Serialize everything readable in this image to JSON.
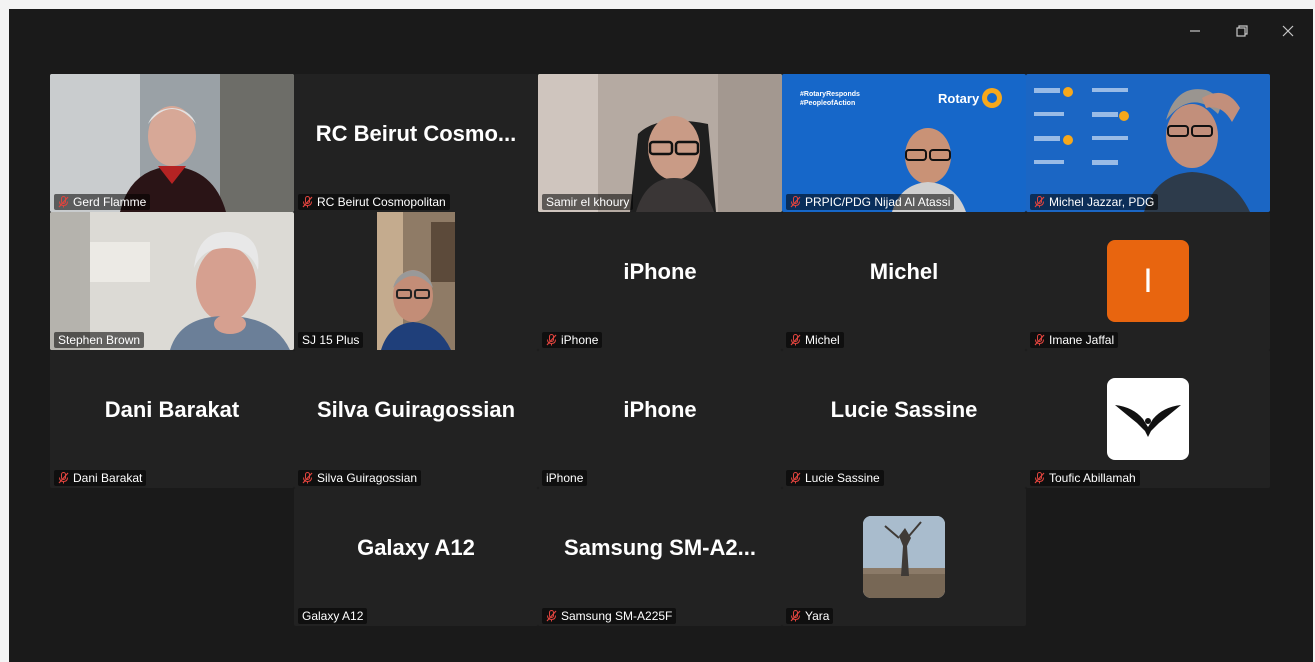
{
  "window_controls": {
    "minimize": "—",
    "restore": "❐",
    "close": "✕"
  },
  "participants": [
    {
      "name": "Gerd Flamme",
      "muted": true
    },
    {
      "name": "RC Beirut Cosmopolitan",
      "display": "RC Beirut Cosmo...",
      "muted": true
    },
    {
      "name": "Samir el khoury",
      "muted": false,
      "active_speaker": true
    },
    {
      "name": "PRPIC/PDG  Nijad Al Atassi",
      "muted": true,
      "banner": {
        "tags": "#RotaryResponds\n#PeopleofAction",
        "logo": "Rotary"
      }
    },
    {
      "name": "Michel Jazzar, PDG",
      "muted": true
    },
    {
      "name": "Stephen Brown",
      "muted": false
    },
    {
      "name": "SJ 15 Plus",
      "muted": false
    },
    {
      "name": "iPhone",
      "display": "iPhone",
      "muted": true
    },
    {
      "name": "Michel",
      "display": "Michel",
      "muted": true
    },
    {
      "name": "Imane Jaffal",
      "muted": true,
      "avatar_letter": "I",
      "avatar_color": "#e8650f"
    },
    {
      "name": "Dani Barakat",
      "display": "Dani Barakat",
      "muted": true
    },
    {
      "name": "Silva Guiragossian",
      "display": "Silva Guiragossian",
      "muted": true
    },
    {
      "name": "iPhone",
      "display": "iPhone",
      "muted": false
    },
    {
      "name": "Lucie Sassine",
      "display": "Lucie Sassine",
      "muted": true
    },
    {
      "name": "Toufic Abillamah",
      "muted": true,
      "avatar_icon": "eagle-icon"
    },
    {
      "name": "Galaxy A12",
      "display": "Galaxy A12",
      "muted": false
    },
    {
      "name": "Samsung SM-A225F",
      "display": "Samsung  SM-A2...",
      "muted": true
    },
    {
      "name": "Yara",
      "muted": true,
      "avatar_icon": "statue-photo"
    }
  ],
  "colors": {
    "active_border": "#21c55d",
    "mute_icon": "#e0443e",
    "tile_bg": "#222222",
    "window_bg": "#1a1a1a"
  }
}
